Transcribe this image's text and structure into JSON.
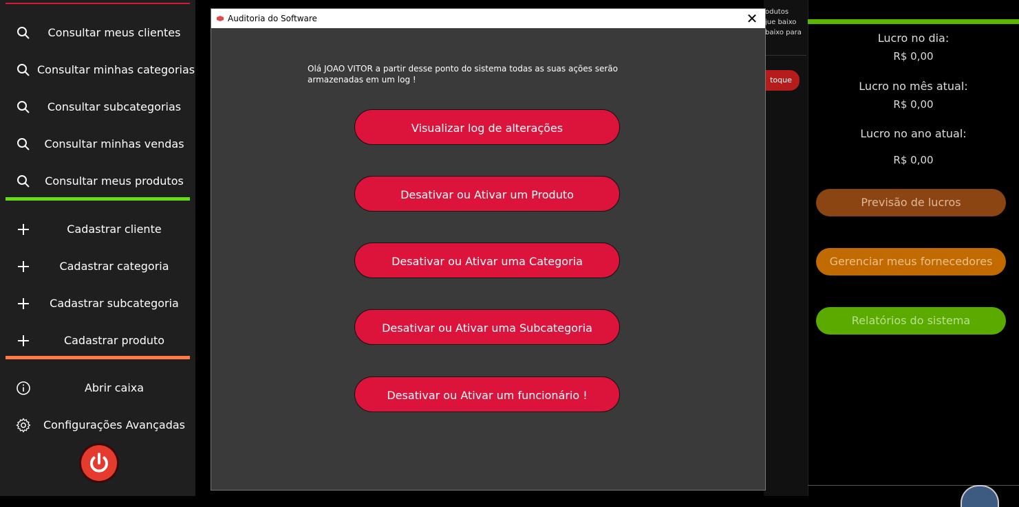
{
  "sidebar": {
    "consult_items": [
      {
        "label": "Consultar meus clientes",
        "icon": "search-icon"
      },
      {
        "label": "Consultar minhas categorias",
        "icon": "search-icon"
      },
      {
        "label": "Consultar subcategorias",
        "icon": "search-icon"
      },
      {
        "label": "Consultar minhas vendas",
        "icon": "search-icon"
      },
      {
        "label": "Consultar meus produtos",
        "icon": "search-icon"
      }
    ],
    "register_items": [
      {
        "label": "Cadastrar cliente",
        "icon": "plus-icon"
      },
      {
        "label": "Cadastrar categoria",
        "icon": "plus-icon"
      },
      {
        "label": "Cadastrar subcategoria",
        "icon": "plus-icon"
      },
      {
        "label": "Cadastrar produto",
        "icon": "plus-icon"
      }
    ],
    "other_items": [
      {
        "label": "Abrir caixa",
        "icon": "info-icon"
      },
      {
        "label": "Configurações Avançadas",
        "icon": "gear-icon"
      }
    ],
    "power_icon": "power-icon",
    "colors": {
      "top_line": "#dc143c",
      "divider_green": "#66dd11",
      "divider_orange": "#ff7a45"
    }
  },
  "background_strip": {
    "lines": [
      "odutos",
      "jue baixo",
      "baixo para"
    ],
    "button_label": "toque"
  },
  "dialog": {
    "title": "Auditoria do Software",
    "close_label": "✕",
    "welcome_text": "Olá JOAO VITOR a partir desse ponto do sistema todas as suas ações serão armazenadas em um log !",
    "buttons": [
      "Visualizar log de alterações",
      "Desativar ou Ativar um Produto",
      "Desativar ou Ativar uma Categoria",
      "Desativar ou Ativar uma Subcategoria",
      "Desativar ou Ativar um funcionário !"
    ],
    "button_color": "#dc143c"
  },
  "right_panel": {
    "profit_day_label": "Lucro no dia:",
    "profit_day_value": "R$ 0,00",
    "profit_month_label": "Lucro no mês atual:",
    "profit_month_value": "R$ 0,00",
    "profit_year_label": "Lucro no ano atual:",
    "profit_year_value": "R$ 0,00",
    "buttons": [
      {
        "label": "Previsão de lucros",
        "color": "#8b4513",
        "text_color": "#e0b89a"
      },
      {
        "label": "Gerenciar meus fornecedores",
        "color": "#c06a00",
        "text_color": "#f0c08a"
      },
      {
        "label": "Relatórios do sistema",
        "color": "#5aaa00",
        "text_color": "#b8e090"
      }
    ]
  }
}
